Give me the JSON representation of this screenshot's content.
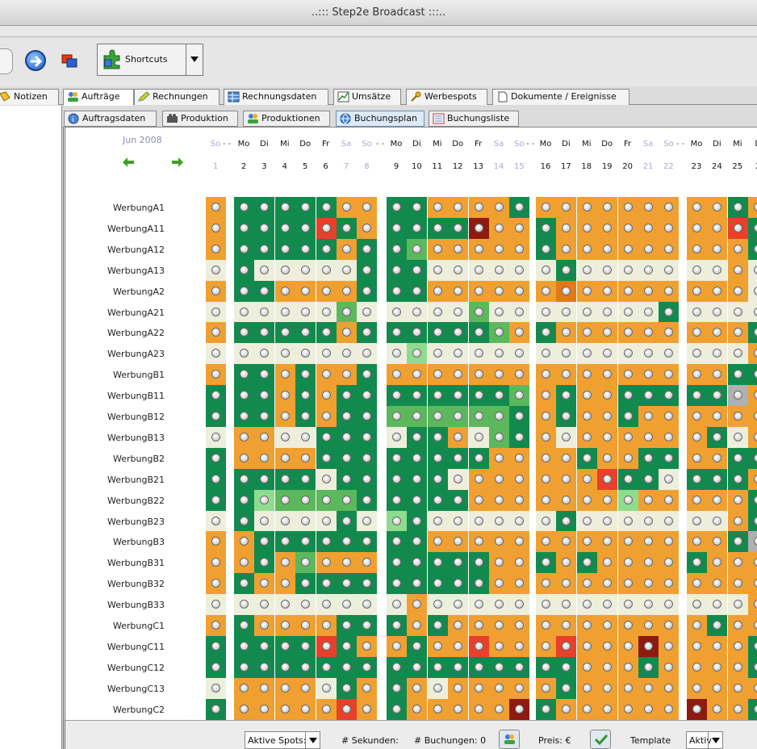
{
  "window": {
    "title": "..::: Step2e Broadcast :::.."
  },
  "toolbar": {
    "shortcuts_label": "Shortcuts"
  },
  "main_tabs": [
    {
      "label": "Notizen",
      "icon": "note-icon"
    },
    {
      "label": "Aufträge",
      "icon": "people-icon"
    },
    {
      "label": "Rechnungen",
      "icon": "pen-icon"
    },
    {
      "label": "Rechnungsdaten",
      "icon": "table-icon"
    },
    {
      "label": "Umsätze",
      "icon": "chart-icon"
    },
    {
      "label": "Werbespots",
      "icon": "key-icon"
    },
    {
      "label": "Dokumente / Ereignisse",
      "icon": "document-icon"
    }
  ],
  "sub_tabs": [
    {
      "label": "Auftragsdaten",
      "icon": "info-icon"
    },
    {
      "label": "Produktion",
      "icon": "camera-icon"
    },
    {
      "label": "Produktionen",
      "icon": "people-icon"
    },
    {
      "label": "Buchungsplan",
      "icon": "globe-icon"
    },
    {
      "label": "Buchungsliste",
      "icon": "list-icon"
    }
  ],
  "calendar": {
    "month": "Jun 2008",
    "weekdays": [
      "So",
      "Mo",
      "Di",
      "Mi",
      "Do",
      "Fr",
      "Sa",
      "So",
      "Mo",
      "Di",
      "Mi",
      "Do",
      "Fr",
      "Sa",
      "So",
      "Mo",
      "Di",
      "Mi",
      "Do",
      "Fr",
      "Sa",
      "So",
      "Mo",
      "Di",
      "Mi",
      "D"
    ],
    "days": [
      "1",
      "2",
      "3",
      "4",
      "5",
      "6",
      "7",
      "8",
      "9",
      "10",
      "11",
      "12",
      "13",
      "14",
      "15",
      "16",
      "17",
      "18",
      "19",
      "20",
      "21",
      "22",
      "23",
      "24",
      "25",
      "2"
    ],
    "separator": "- -"
  },
  "colors": {
    "green": "#128a4e",
    "light_green": "#5cb85c",
    "pale_green": "#8fdc8f",
    "orange": "#f0a030",
    "dark_orange": "#e07a18",
    "cream": "#eeeedd",
    "red": "#e8402a",
    "dark_red": "#8e1a10",
    "gray": "#b0b0b0"
  },
  "rows": [
    {
      "label": "WerbungA1",
      "cells": "o.gggggoo.ggoooogoo.ooooooog.oggg"
    },
    {
      "label": "WerbungA11",
      "cells": "o.ggggrgo.ggggxoog.oooooooo.rgog"
    },
    {
      "label": "WerbungA12",
      "cells": "o.gggggog.glooooog.oooooooo.oggg"
    },
    {
      "label": "WerbungA13",
      "cells": "c.gcccccg.ggcccccc.gccccccc.occc"
    },
    {
      "label": "WerbungA2",
      "cells": "o.ggoooog.ggoooooo.Dooooooo.occo"
    },
    {
      "label": "WerbungA21",
      "cells": "c.ccccclc.cccclccc.cccccgcc.cccc"
    },
    {
      "label": "WerbungA22",
      "cells": "o.gggggog.ggggglog.oooooooo.oggg"
    },
    {
      "label": "WerbungA23",
      "cells": "c.cccccccc.pccccccc.cccccccc.occc"
    },
    {
      "label": "WerbungB1",
      "cells": "o.ggogoog.oooooooo.oooooooo.gggg"
    },
    {
      "label": "WerbungB11",
      "cells": "g.ggogogg.gggggglo.googgggg.Gogg"
    },
    {
      "label": "WerbungB12",
      "cells": "g.ggogogg.llllllgo.googoooo.ooll"
    },
    {
      "label": "WerbungB13",
      "cells": "c.ooccgggc.ggoclgoc.oooooogc.oGoo"
    },
    {
      "label": "WerbungB2",
      "cells": "g.ooooggg.gggggooo.ogooggoo.gggg"
    },
    {
      "label": "WerbungB21",
      "cells": "g.ggggcggg.ggcooooo.orggcggg.oggg"
    },
    {
      "label": "WerbungB22",
      "cells": "g.gpllllg.ggggoooo.ooopoooo.oggo"
    },
    {
      "label": "WerbungB23",
      "cells": "c.gccccgc.pgcccccc.gccccccc.ogcg"
    },
    {
      "label": "WerbungB3",
      "cells": "o.ogggggg.ggoooooo.oooooooog.Gggo"
    },
    {
      "label": "WerbungB31",
      "cells": "o.ogolooog.ggggoogo.goooogoo.oggo"
    },
    {
      "label": "WerbungB32",
      "cells": "o.googgggg.ggggoooo.ooooooooo.gGog"
    },
    {
      "label": "WerbungB33",
      "cells": "c.cccccccc.occccccc.cccccccc.occc"
    },
    {
      "label": "WerbungC1",
      "cells": "o.gooooggg.ogoooooo.oooooogo.oggg"
    },
    {
      "label": "WerbungC11",
      "cells": "g.ggggrgo.ogoorooo.roooxooo.oggg"
    },
    {
      "label": "WerbungC12",
      "cells": "g.ggggggg.gggggggg.gooogooo.oggg"
    },
    {
      "label": "WerbungC13",
      "cells": "c.oooocgo.gocooooo.gooooooo.oooc"
    },
    {
      "label": "WerbungC2",
      "cells": "g.ooooorog.oooooxgo.oooooxoo.gooo"
    }
  ],
  "statusbar": {
    "aktive_spots": "Aktive Spots:",
    "sekunden": "# Sekunden:",
    "buchungen": "# Buchungen: 0",
    "preis": "Preis: €",
    "template": "Template",
    "aktiv": "Aktiv"
  }
}
